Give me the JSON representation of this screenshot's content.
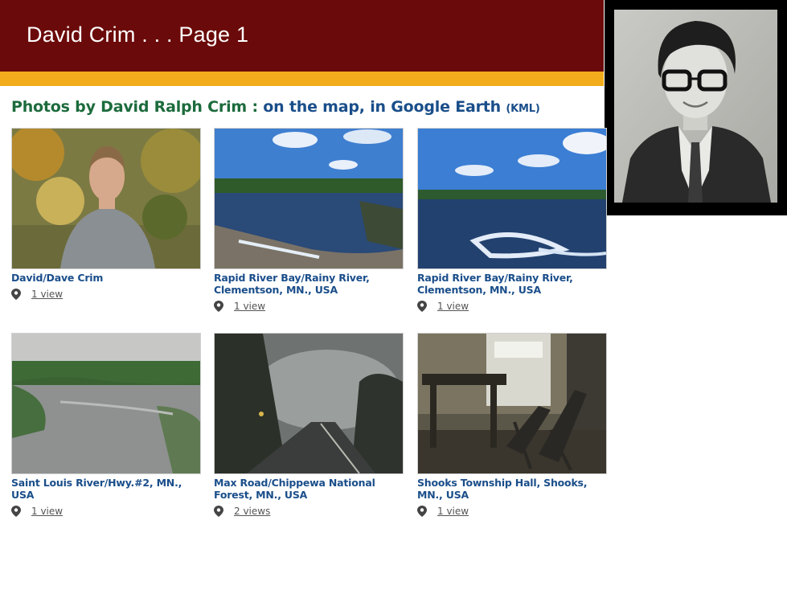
{
  "slide": {
    "title": "David Crim . . . Page 1"
  },
  "heading": {
    "lead": "Photos by David Ralph Crim",
    "separator": ":",
    "map_link": "on the map",
    "earth_link": "in Google Earth",
    "kml_link": "(KML)"
  },
  "photos": [
    {
      "title": "David/Dave Crim",
      "views": "1 view"
    },
    {
      "title": "Rapid River Bay/Rainy River, Clementson, MN., USA",
      "views": "1 view"
    },
    {
      "title": "Rapid River Bay/Rainy River, Clementson, MN., USA",
      "views": "1 view"
    },
    {
      "title": "Saint Louis River/Hwy.#2, MN., USA",
      "views": "1 view"
    },
    {
      "title": "Max Road/Chippewa National Forest, MN., USA",
      "views": "2 views"
    },
    {
      "title": "Shooks Township Hall, Shooks, MN., USA",
      "views": "1 view"
    }
  ],
  "colors": {
    "banner": "#6b0a0a",
    "gold_bar": "#f2ac1c",
    "heading_green": "#1c6b3c",
    "link_blue": "#1a4e8a"
  },
  "icons": {
    "location": "map-pin-icon"
  }
}
